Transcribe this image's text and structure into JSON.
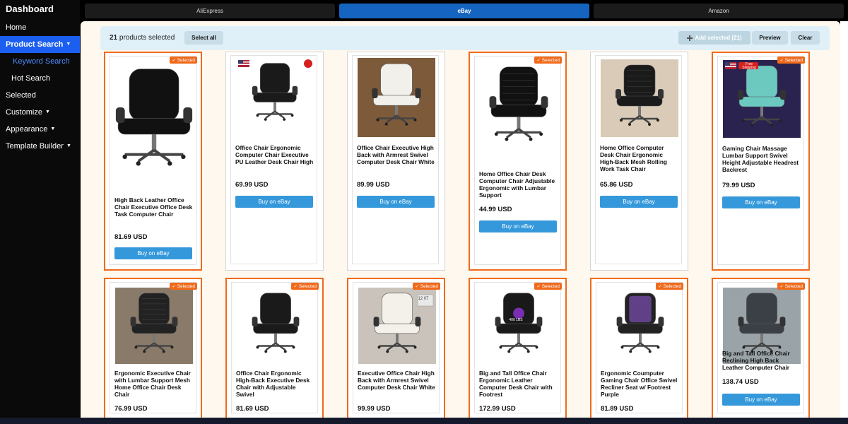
{
  "sidebar": {
    "brand": "Dashboard",
    "items": [
      {
        "label": "Home"
      },
      {
        "label": "Product Search"
      },
      {
        "label": "Keyword Search"
      },
      {
        "label": "Hot Search"
      },
      {
        "label": "Selected"
      },
      {
        "label": "Customize"
      },
      {
        "label": "Appearance"
      },
      {
        "label": "Template Builder"
      }
    ]
  },
  "tabs": [
    {
      "label": "AliExpress"
    },
    {
      "label": "eBay"
    },
    {
      "label": "Amazon"
    }
  ],
  "toolbar": {
    "selected_count": "21",
    "selected_text": "products selected",
    "select_all": "Select all",
    "add_selected": "Add selected (21)",
    "preview": "Preview",
    "clear": "Clear"
  },
  "badge_text": "✓ Selected",
  "buy_label": "Buy on eBay",
  "products": [
    {
      "title": "High Back Leather Office Chair Executive Office Desk Task Computer Chair",
      "price": "81.69 USD",
      "selected": true
    },
    {
      "title": "Office Chair Ergonomic Computer Chair Executive PU Leather Desk Chair High",
      "price": "69.99 USD",
      "selected": false
    },
    {
      "title": "Office Chair Executive High Back with Armrest Swivel Computer Desk Chair White",
      "price": "89.99 USD",
      "selected": false
    },
    {
      "title": "Home Office Chair Desk Computer Chair Adjustable Ergonomic with Lumbar Support",
      "price": "44.99 USD",
      "selected": true
    },
    {
      "title": "Home Office Computer Desk Chair Ergonomic High-Back Mesh Rolling Work Task Chair",
      "price": "65.86 USD",
      "selected": false
    },
    {
      "title": "Gaming Chair Massage Lumbar Support Swivel Height Adjustable Headrest Backrest",
      "price": "79.99 USD",
      "selected": true
    },
    {
      "title": "Ergonomic Executive Chair with Lumbar Support Mesh Home Office Chair Desk Chair",
      "price": "76.99 USD",
      "selected": true
    },
    {
      "title": "Office Chair Ergonomic High-Back Executive Desk Chair with Adjustable Swivel",
      "price": "81.69 USD",
      "selected": true
    },
    {
      "title": "Executive Office Chair High Back with Armrest Swivel Computer Desk Chair White",
      "price": "99.99 USD",
      "selected": true
    },
    {
      "title": "Big and Tall Office Chair Ergonomic Leather Computer Desk Chair with Footrest",
      "price": "172.99 USD",
      "selected": true
    },
    {
      "title": "Ergonomic Coumputer Gaming Chair Office Swivel Recliner Seat w/ Footrest Purple",
      "price": "81.89 USD",
      "selected": true
    },
    {
      "title": "Big and Tall Office Chair Reclining High Back Leather Computer Chair",
      "price": "138.74 USD",
      "selected": true
    }
  ],
  "image_labels": {
    "free_shipping": "Free Shipping",
    "lbs": "400 LBS",
    "calendar": "12 07"
  },
  "colors": {
    "accent": "#1c5ff0",
    "selected_border": "#f06a1c",
    "buy_button": "#3498db",
    "active_tab": "#1565c0",
    "page_bg": "#fff8ee"
  }
}
